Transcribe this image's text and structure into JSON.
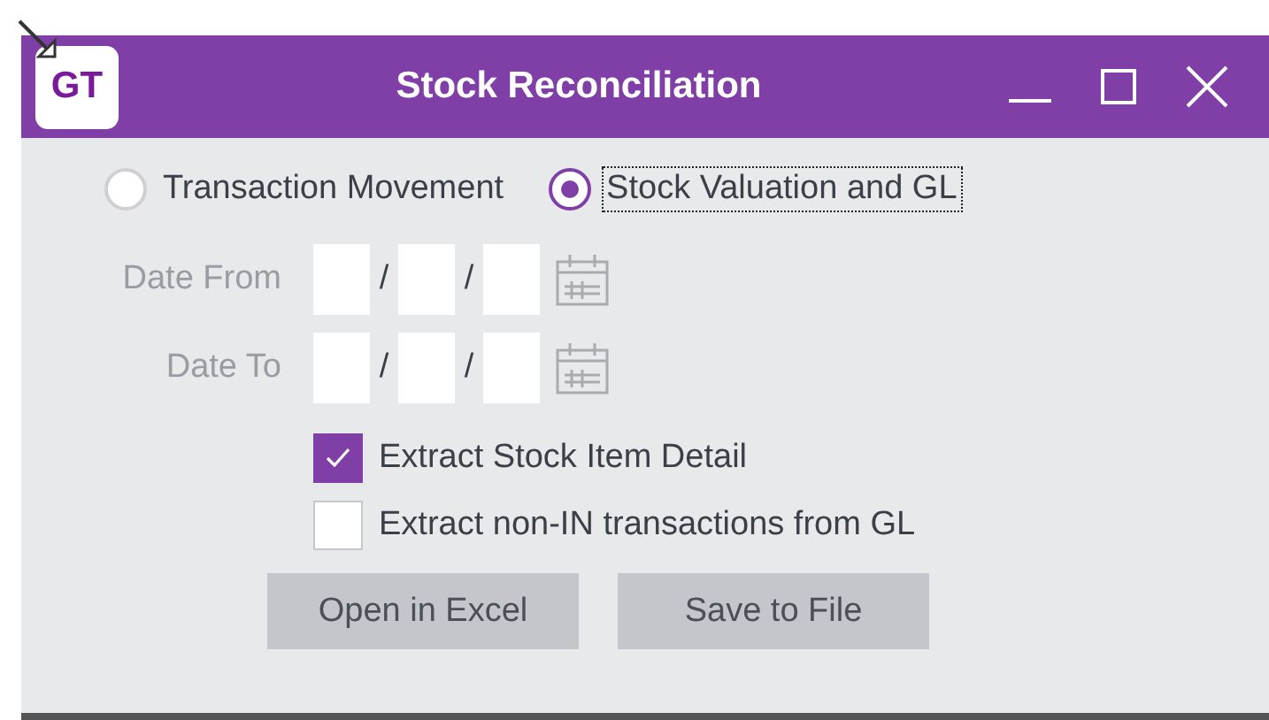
{
  "window": {
    "title": "Stock Reconciliation",
    "logo": "GT"
  },
  "report_type": [
    {
      "label": "Transaction Movement",
      "selected": false,
      "focused": false
    },
    {
      "label": "Stock Valuation and GL",
      "selected": true,
      "focused": true
    }
  ],
  "date_fields": [
    {
      "label": "Date From",
      "disabled": true,
      "separators": [
        "/",
        "/"
      ]
    },
    {
      "label": "Date To",
      "disabled": true,
      "separators": [
        "/",
        "/"
      ]
    }
  ],
  "options": [
    {
      "label": "Extract Stock Item Detail",
      "checked": true
    },
    {
      "label": "Extract non-IN transactions from GL",
      "checked": false
    }
  ],
  "buttons": [
    "Open in Excel",
    "Save to File"
  ]
}
